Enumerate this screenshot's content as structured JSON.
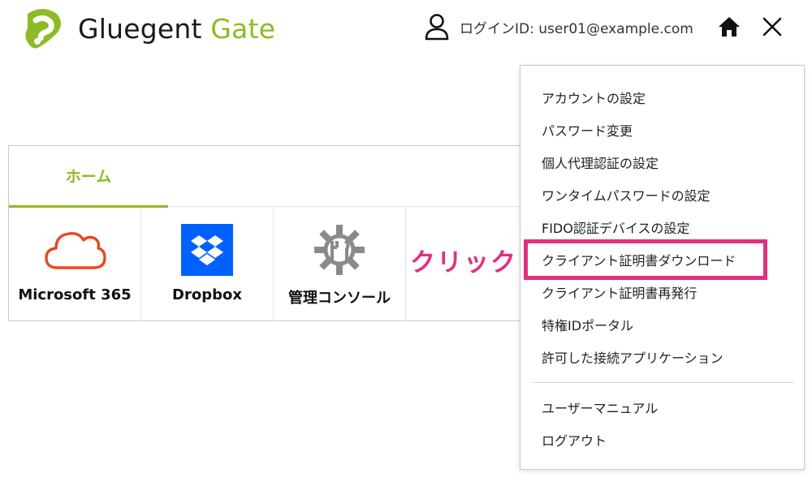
{
  "header": {
    "logo_word1": "Gluegent",
    "logo_word2": "Gate",
    "login_label": "ログインID: user01@example.com",
    "icons": {
      "user": "user-icon",
      "home": "home-icon",
      "close": "close-icon"
    }
  },
  "tabs": [
    {
      "label": "ホーム"
    }
  ],
  "apps": [
    {
      "label": "Microsoft 365",
      "icon": "cloud-icon"
    },
    {
      "label": "Dropbox",
      "icon": "dropbox-icon"
    },
    {
      "label": "管理コンソール",
      "icon": "gear-wrench-icon"
    }
  ],
  "annotation": {
    "text": "クリック"
  },
  "menu": {
    "items": [
      "アカウントの設定",
      "パスワード変更",
      "個人代理認証の設定",
      "ワンタイムパスワードの設定",
      "FIDO認証デバイスの設定",
      "クライアント証明書ダウンロード",
      "クライアント証明書再発行",
      "特権IDポータル",
      "許可した接続アプリケーション"
    ],
    "footer_items": [
      "ユーザーマニュアル",
      "ログアウト"
    ]
  },
  "colors": {
    "brand_green": "#8dbb24",
    "highlight_pink": "#e0307f",
    "ms365_orange": "#e8471f",
    "dropbox_blue": "#0061fe"
  }
}
